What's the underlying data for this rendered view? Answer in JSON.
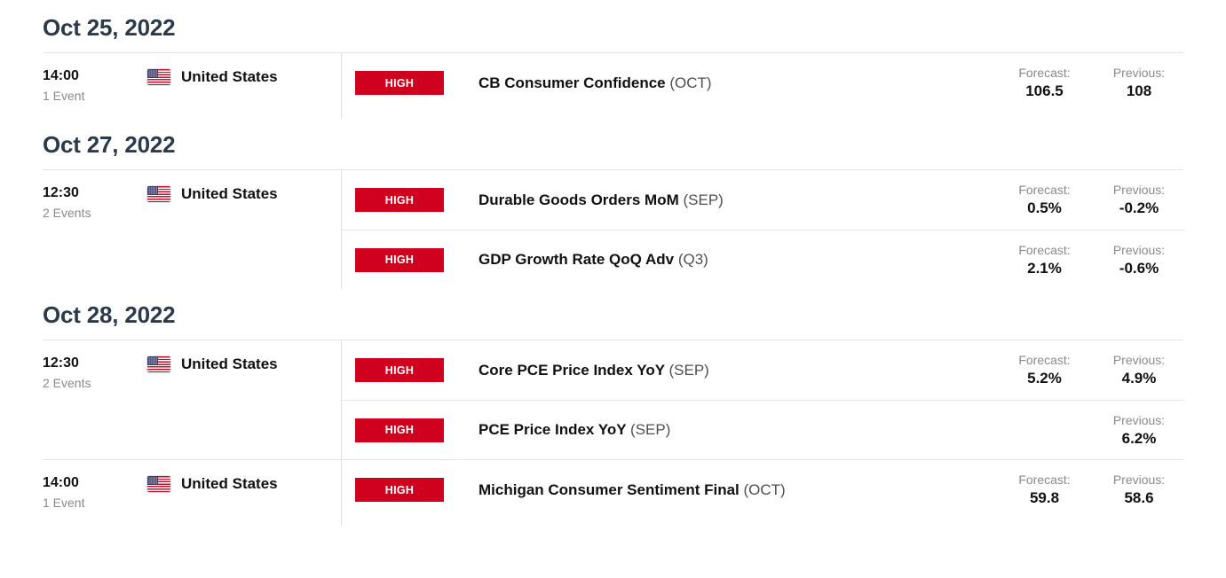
{
  "theme": {
    "impact_high_color": "#d0011f",
    "date_header_color": "#2b3a4a",
    "muted_text_color": "#8a8a8a",
    "separator_color": "#e3e3e3"
  },
  "labels": {
    "forecast": "Forecast:",
    "previous": "Previous:",
    "flag_icon": "united-states-flag-icon"
  },
  "groups": [
    {
      "date": "Oct 25, 2022",
      "rows": [
        {
          "time": "14:00",
          "event_count": "1 Event",
          "country": "United States",
          "events": [
            {
              "impact": "HIGH",
              "name": "CB Consumer Confidence",
              "period": "(OCT)",
              "forecast_label": "Forecast:",
              "forecast": "106.5",
              "previous_label": "Previous:",
              "previous": "108",
              "has_forecast": true
            }
          ]
        }
      ]
    },
    {
      "date": "Oct 27, 2022",
      "rows": [
        {
          "time": "12:30",
          "event_count": "2 Events",
          "country": "United States",
          "events": [
            {
              "impact": "HIGH",
              "name": "Durable Goods Orders MoM",
              "period": "(SEP)",
              "forecast_label": "Forecast:",
              "forecast": "0.5%",
              "previous_label": "Previous:",
              "previous": "-0.2%",
              "has_forecast": true
            },
            {
              "impact": "HIGH",
              "name": "GDP Growth Rate QoQ Adv",
              "period": "(Q3)",
              "forecast_label": "Forecast:",
              "forecast": "2.1%",
              "previous_label": "Previous:",
              "previous": "-0.6%",
              "has_forecast": true
            }
          ]
        }
      ]
    },
    {
      "date": "Oct 28, 2022",
      "rows": [
        {
          "time": "12:30",
          "event_count": "2 Events",
          "country": "United States",
          "events": [
            {
              "impact": "HIGH",
              "name": "Core PCE Price Index YoY",
              "period": "(SEP)",
              "forecast_label": "Forecast:",
              "forecast": "5.2%",
              "previous_label": "Previous:",
              "previous": "4.9%",
              "has_forecast": true
            },
            {
              "impact": "HIGH",
              "name": "PCE Price Index YoY",
              "period": "(SEP)",
              "forecast_label": "",
              "forecast": "",
              "previous_label": "Previous:",
              "previous": "6.2%",
              "has_forecast": false
            }
          ]
        },
        {
          "time": "14:00",
          "event_count": "1 Event",
          "country": "United States",
          "events": [
            {
              "impact": "HIGH",
              "name": "Michigan Consumer Sentiment Final",
              "period": "(OCT)",
              "forecast_label": "Forecast:",
              "forecast": "59.8",
              "previous_label": "Previous:",
              "previous": "58.6",
              "has_forecast": true
            }
          ]
        }
      ]
    }
  ]
}
